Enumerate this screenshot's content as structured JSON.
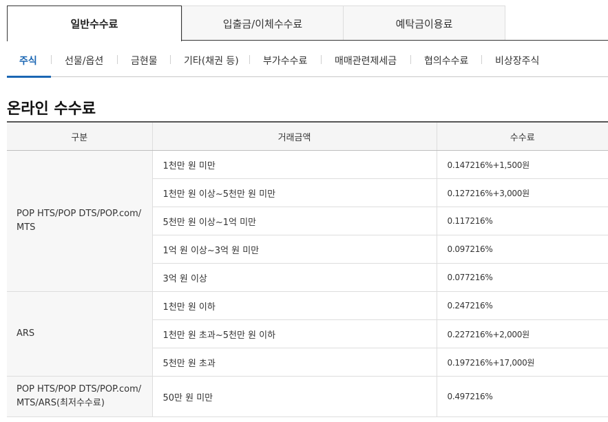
{
  "top_tabs": [
    {
      "label": "일반수수료",
      "active": true
    },
    {
      "label": "입출금/이체수수료",
      "active": false
    },
    {
      "label": "예탁금이용료",
      "active": false
    }
  ],
  "sub_tabs": [
    {
      "label": "주식",
      "active": true
    },
    {
      "label": "선물/옵션",
      "active": false
    },
    {
      "label": "금현물",
      "active": false
    },
    {
      "label": "기타(채권 등)",
      "active": false
    },
    {
      "label": "부가수수료",
      "active": false
    },
    {
      "label": "매매관련제세금",
      "active": false
    },
    {
      "label": "협의수수료",
      "active": false
    },
    {
      "label": "비상장주식",
      "active": false
    }
  ],
  "section_title": "온라인 수수료",
  "table": {
    "headers": [
      "구분",
      "거래금액",
      "수수료"
    ],
    "groups": [
      {
        "name_line1": "POP HTS/POP DTS/POP.com/",
        "name_line2": "MTS",
        "rows": [
          {
            "amount": "1천만 원 미만",
            "fee": "0.147216%+1,500원"
          },
          {
            "amount": "1천만 원 이상~5천만 원 미만",
            "fee": "0.127216%+3,000원"
          },
          {
            "amount": "5천만 원 이상~1억 미만",
            "fee": "0.117216%"
          },
          {
            "amount": "1억 원 이상~3억 원 미만",
            "fee": "0.097216%"
          },
          {
            "amount": "3억 원 이상",
            "fee": "0.077216%"
          }
        ]
      },
      {
        "name_line1": "ARS",
        "name_line2": "",
        "rows": [
          {
            "amount": "1천만 원 이하",
            "fee": "0.247216%"
          },
          {
            "amount": "1천만 원 초과~5천만 원 이하",
            "fee": "0.227216%+2,000원"
          },
          {
            "amount": "5천만 원 초과",
            "fee": "0.197216%+17,000원"
          }
        ]
      },
      {
        "name_line1": "POP HTS/POP DTS/POP.com/",
        "name_line2": "MTS/ARS(최저수수료)",
        "rows": [
          {
            "amount": "50만 원 미만",
            "fee": "0.497216%"
          }
        ]
      }
    ]
  },
  "colors": {
    "accent": "#1a66b3",
    "header_bg": "#f5f5f5",
    "group_bg": "#f7f7f7"
  }
}
